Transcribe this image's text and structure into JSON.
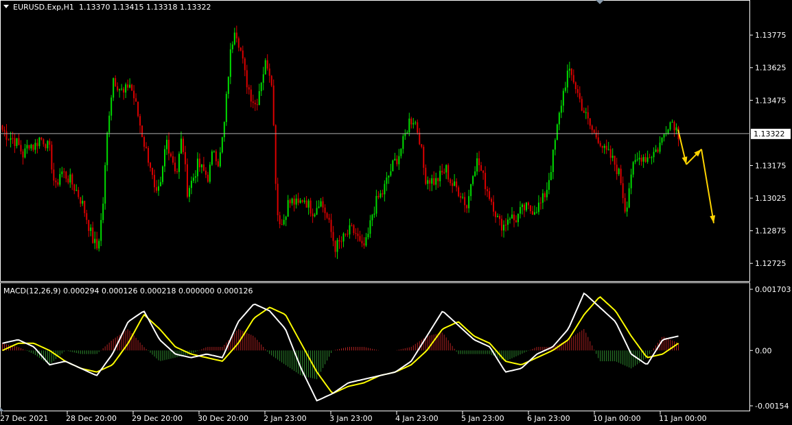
{
  "chart_data": [
    {
      "type": "candlestick",
      "symbol": "EURUSD.Exp,H1",
      "ohlc_header": "1.13370 1.13415 1.13318 1.13322",
      "current_price": 1.13322,
      "current_price_label": "1.13322",
      "ylim": [
        1.1265,
        1.1393
      ],
      "y_ticks": [
        1.13775,
        1.13625,
        1.13475,
        1.13325,
        1.13175,
        1.13025,
        1.12875,
        1.12725
      ],
      "y_tick_labels": [
        "1.13775",
        "1.13625",
        "1.13475",
        "1.13175",
        "1.13025",
        "1.12875",
        "1.12725"
      ],
      "x_labels": [
        "27 Dec 2021",
        "28 Dec 20:00",
        "29 Dec 20:00",
        "30 Dec 20:00",
        "2 Jan 23:00",
        "3 Jan 23:00",
        "4 Jan 23:00",
        "5 Jan 23:00",
        "6 Jan 23:00",
        "10 Jan 00:00",
        "11 Jan 00:00"
      ],
      "close_path": [
        1.1334,
        1.1331,
        1.133,
        1.1327,
        1.1322,
        1.1328,
        1.1326,
        1.133,
        1.1329,
        1.1324,
        1.1306,
        1.1315,
        1.1313,
        1.131,
        1.1306,
        1.1301,
        1.1293,
        1.1284,
        1.1279,
        1.1298,
        1.1338,
        1.1358,
        1.1354,
        1.135,
        1.1356,
        1.1348,
        1.1337,
        1.1326,
        1.1318,
        1.1302,
        1.1308,
        1.133,
        1.1322,
        1.1314,
        1.1331,
        1.1306,
        1.1311,
        1.1318,
        1.1315,
        1.1312,
        1.1326,
        1.1318,
        1.1336,
        1.1366,
        1.1382,
        1.1372,
        1.1358,
        1.135,
        1.1345,
        1.1357,
        1.1366,
        1.1357,
        1.1296,
        1.129,
        1.13,
        1.1301,
        1.1299,
        1.1303,
        1.1299,
        1.1296,
        1.1302,
        1.1297,
        1.1289,
        1.128,
        1.1282,
        1.1285,
        1.1288,
        1.1286,
        1.1279,
        1.1282,
        1.1295,
        1.1302,
        1.1305,
        1.1312,
        1.1318,
        1.1322,
        1.1329,
        1.1338,
        1.1339,
        1.133,
        1.1312,
        1.1311,
        1.131,
        1.1313,
        1.1316,
        1.1309,
        1.1307,
        1.1304,
        1.1298,
        1.1315,
        1.132,
        1.1312,
        1.1305,
        1.1299,
        1.1291,
        1.129,
        1.1295,
        1.1292,
        1.1296,
        1.1298,
        1.1297,
        1.1298,
        1.13,
        1.1306,
        1.1318,
        1.1334,
        1.1349,
        1.136,
        1.1358,
        1.135,
        1.1343,
        1.1337,
        1.1332,
        1.133,
        1.1324,
        1.1322,
        1.1318,
        1.1312,
        1.1296,
        1.1314,
        1.1319,
        1.1322,
        1.1321,
        1.1323,
        1.1325,
        1.133,
        1.1337,
        1.1338,
        1.1332
      ],
      "projected_arrows": [
        [
          1.1334,
          1.1318,
          1.1325
        ],
        [
          1.1325,
          1.1291
        ]
      ]
    },
    {
      "type": "macd",
      "header": "MACD(12,26,9) 0.000294 0.000126 0.000218 0.000000 0.000126",
      "ylim": [
        -0.00154,
        0.001703
      ],
      "y_ticks": [
        0.001703,
        0.0,
        -0.00154
      ],
      "y_tick_labels": [
        "0.001703",
        "0.00",
        "-0.00154"
      ],
      "macd_line": [
        0.0002,
        0.0003,
        0.0001,
        -0.0004,
        -0.0003,
        -0.0005,
        -0.0007,
        -0.0001,
        0.0008,
        0.0011,
        0.0003,
        -0.0001,
        -0.0002,
        -0.0001,
        -0.0002,
        0.0008,
        0.0013,
        0.0011,
        0.0006,
        -0.0005,
        -0.0014,
        -0.0012,
        -0.0009,
        -0.0008,
        -0.0007,
        -0.0006,
        -0.0003,
        0.0004,
        0.0011,
        0.0007,
        0.0003,
        0.0001,
        -0.0006,
        -0.0005,
        -0.0001,
        0.0001,
        0.0006,
        0.0016,
        0.0012,
        0.0008,
        -0.0001,
        -0.0004,
        0.0003,
        0.0004
      ],
      "signal_line": [
        0.0,
        0.0002,
        0.0002,
        0.0,
        -0.0003,
        -0.0005,
        -0.0006,
        -0.0004,
        0.0002,
        0.001,
        0.0006,
        0.0001,
        -0.0001,
        -0.0002,
        -0.0003,
        0.0002,
        0.0009,
        0.0012,
        0.001,
        0.0002,
        -0.0006,
        -0.0012,
        -0.001,
        -0.0009,
        -0.0007,
        -0.0006,
        -0.0004,
        0.0,
        0.0006,
        0.0008,
        0.0004,
        0.0002,
        -0.0003,
        -0.0004,
        -0.0002,
        0.0,
        0.0003,
        0.001,
        0.0015,
        0.0011,
        0.0004,
        -0.0002,
        -0.0001,
        0.0002
      ],
      "histogram": [
        0.0002,
        0.0001,
        -0.0001,
        -0.0004,
        0.0,
        -0.0001,
        -0.0001,
        0.0003,
        0.0006,
        0.0001,
        -0.0003,
        -0.0002,
        -0.0001,
        0.0001,
        0.0001,
        0.0006,
        0.0004,
        -0.0001,
        -0.0004,
        -0.0007,
        -0.0008,
        0.0,
        0.0001,
        0.0001,
        0.0,
        0.0,
        0.0001,
        0.0004,
        0.0005,
        -0.0001,
        -0.0001,
        -0.0001,
        -0.0003,
        -0.0001,
        0.0001,
        0.0001,
        0.0003,
        0.0006,
        -0.0003,
        -0.0003,
        -0.0005,
        -0.0002,
        0.0004,
        0.0002
      ],
      "colors": {
        "macd_line": "#ffffff",
        "signal_line": "#ffff00",
        "hist_positive": "#b22222",
        "hist_negative": "#2e8b2e"
      }
    }
  ],
  "colors": {
    "background": "#000000",
    "bull": "#00dd00",
    "bear": "#dd0000",
    "arrows": "#ffd400",
    "grid": "#ffffff",
    "price_line": "#c0c0c0"
  },
  "icons": {
    "collapse": "triangle-down-icon"
  }
}
